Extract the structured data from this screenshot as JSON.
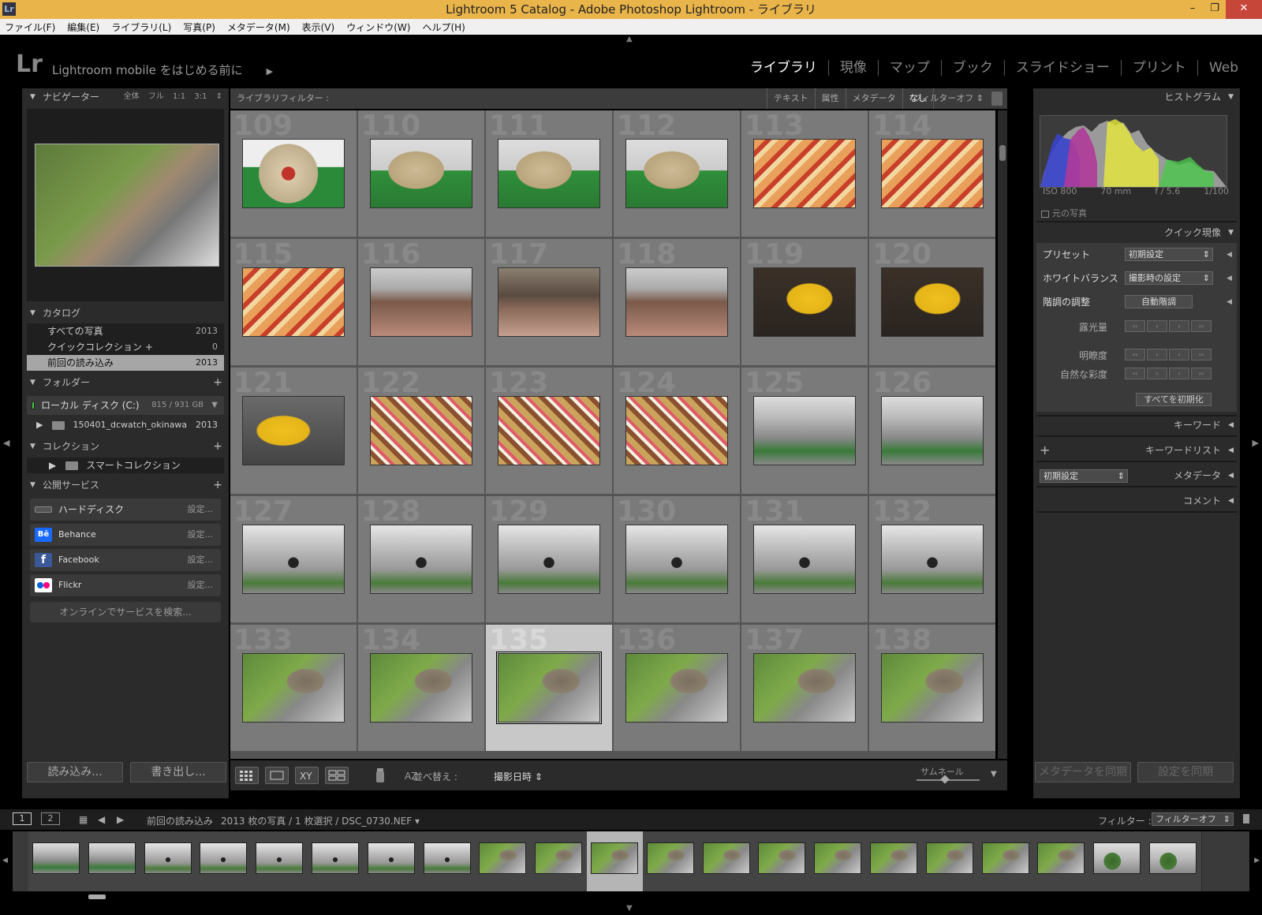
{
  "window": {
    "title": "Lightroom 5 Catalog - Adobe Photoshop Lightroom - ライブラリ",
    "logo": "Lr"
  },
  "menu": [
    "ファイル(F)",
    "編集(E)",
    "ライブラリ(L)",
    "写真(P)",
    "メタデータ(M)",
    "表示(V)",
    "ウィンドウ(W)",
    "ヘルプ(H)"
  ],
  "identity": {
    "logo": "Lr",
    "mobile_text": "Lightroom mobile をはじめる前に",
    "mobile_arrow": "▶"
  },
  "modules": [
    "ライブラリ",
    "現像",
    "マップ",
    "ブック",
    "スライドショー",
    "プリント",
    "Web"
  ],
  "active_module": "ライブラリ",
  "left": {
    "navigator": {
      "title": "ナビゲーター",
      "opts": [
        "全体",
        "フル",
        "1:1",
        "3:1"
      ]
    },
    "catalog": {
      "title": "カタログ",
      "rows": [
        {
          "label": "すべての写真",
          "count": "2013"
        },
        {
          "label": "クイックコレクション +",
          "count": "0"
        },
        {
          "label": "前回の読み込み",
          "count": "2013"
        }
      ]
    },
    "folders": {
      "title": "フォルダー",
      "disk": "ローカル ディスク (C:)",
      "disk_size": "815 / 931 GB",
      "folder": "150401_dcwatch_okinawa",
      "folder_count": "2013"
    },
    "collections": {
      "title": "コレクション",
      "item": "スマートコレクション"
    },
    "publish": {
      "title": "公開サービス",
      "services": [
        {
          "name": "ハードディスク",
          "setting": "設定..."
        },
        {
          "name": "Behance",
          "setting": "設定...",
          "icon": "Bē"
        },
        {
          "name": "Facebook",
          "setting": "設定...",
          "icon": "f"
        },
        {
          "name": "Flickr",
          "setting": "設定..."
        }
      ],
      "search": "オンラインでサービスを検索..."
    },
    "import_btn": "読み込み...",
    "export_btn": "書き出し..."
  },
  "filterbar": {
    "label": "ライブラリフィルター :",
    "options": [
      "テキスト",
      "属性",
      "メタデータ",
      "なし"
    ],
    "active": "なし",
    "filter_off": "フィルターオフ ⇕"
  },
  "grid": {
    "rows": [
      [
        {
          "n": "109",
          "img": "animal"
        },
        {
          "n": "110",
          "img": "lion"
        },
        {
          "n": "111",
          "img": "lion"
        },
        {
          "n": "112",
          "img": "lion"
        },
        {
          "n": "113",
          "img": "fruit"
        },
        {
          "n": "114",
          "img": "fruit"
        }
      ],
      [
        {
          "n": "115",
          "img": "fruit"
        },
        {
          "n": "116",
          "img": "market"
        },
        {
          "n": "117",
          "img": "market2"
        },
        {
          "n": "118",
          "img": "market"
        },
        {
          "n": "119",
          "img": "banana"
        },
        {
          "n": "120",
          "img": "banana"
        }
      ],
      [
        {
          "n": "121",
          "img": "bananab"
        },
        {
          "n": "122",
          "img": "lanterns"
        },
        {
          "n": "123",
          "img": "lanterns"
        },
        {
          "n": "124",
          "img": "lanterns"
        },
        {
          "n": "125",
          "img": "alley"
        },
        {
          "n": "126",
          "img": "alley"
        }
      ],
      [
        {
          "n": "127",
          "img": "moto"
        },
        {
          "n": "128",
          "img": "moto"
        },
        {
          "n": "129",
          "img": "moto"
        },
        {
          "n": "130",
          "img": "moto"
        },
        {
          "n": "131",
          "img": "moto"
        },
        {
          "n": "132",
          "img": "moto"
        }
      ],
      [
        {
          "n": "133",
          "img": "cat"
        },
        {
          "n": "134",
          "img": "cat"
        },
        {
          "n": "135",
          "img": "cat",
          "selected": true
        },
        {
          "n": "136",
          "img": "cat"
        },
        {
          "n": "137",
          "img": "cat"
        },
        {
          "n": "138",
          "img": "cat"
        }
      ]
    ]
  },
  "toolbar": {
    "sort_label": "並べ替え :",
    "sort_value": "撮影日時 ⇕",
    "thumbnail_label": "サムネール"
  },
  "right": {
    "histogram": {
      "title": "ヒストグラム",
      "iso": "ISO 800",
      "focal": "70 mm",
      "aperture": "f / 5.6",
      "shutter": "1/100",
      "original": "元の写真"
    },
    "quick_develop": {
      "title": "クイック現像",
      "preset_label": "プリセット",
      "preset_value": "初期設定",
      "wb_label": "ホワイトバランス",
      "wb_value": "撮影時の設定",
      "tone_label": "階調の調整",
      "tone_btn": "自動階調",
      "exposure": "露光量",
      "clarity": "明瞭度",
      "vibrance": "自然な彩度",
      "reset": "すべてを初期化"
    },
    "keywords": "キーワード",
    "keyword_list": "キーワードリスト",
    "metadata_preset": "初期設定",
    "metadata": "メタデータ",
    "comments": "コメント",
    "sync_metadata": "メタデータを同期",
    "sync_settings": "設定を同期"
  },
  "filmstrip_bar": {
    "page1": "1",
    "page2": "2",
    "source": "前回の読み込み",
    "info": "2013 枚の写真 / 1 枚選択 / DSC_0730.NEF ▾",
    "filter_label": "フィルター :",
    "filter_value": "フィルターオフ"
  },
  "filmstrip": [
    "alley",
    "alley",
    "moto",
    "moto",
    "moto",
    "moto",
    "moto",
    "moto",
    "cat",
    "cat",
    "cat",
    "cat",
    "cat",
    "cat",
    "cat",
    "cat",
    "cat",
    "cat",
    "cat",
    "plant",
    "plant"
  ],
  "filmstrip_selected": 10
}
